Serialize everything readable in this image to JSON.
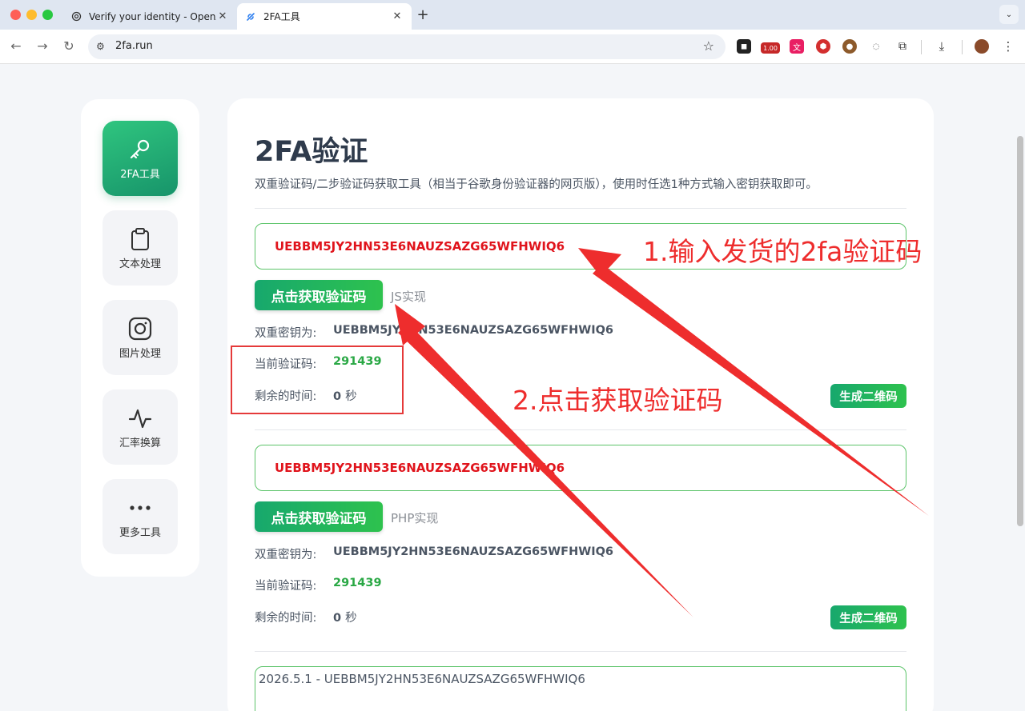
{
  "browser": {
    "tabs": [
      {
        "title": "Verify your identity - OpenAI",
        "icon": "openai-icon",
        "active": false
      },
      {
        "title": "2FA工具",
        "icon": "2fa-site-icon",
        "active": true
      }
    ],
    "url": "2fa.run",
    "extension_badge": "1.00"
  },
  "sidebar": {
    "items": [
      {
        "label": "2FA工具",
        "icon": "key-icon",
        "active": true
      },
      {
        "label": "文本处理",
        "icon": "clipboard-icon",
        "active": false
      },
      {
        "label": "图片处理",
        "icon": "camera-icon",
        "active": false
      },
      {
        "label": "汇率换算",
        "icon": "activity-icon",
        "active": false
      },
      {
        "label": "更多工具",
        "icon": "more-dots-icon",
        "active": false
      }
    ]
  },
  "main": {
    "title": "2FA验证",
    "description": "双重验证码/二步验证码获取工具（相当于谷歌身份验证器的网页版），使用时任选1种方式输入密钥获取即可。",
    "sections": [
      {
        "secret_value": "UEBBM5JY2HN53E6NAUZSAZG65WFHWIQ6",
        "button_label": "点击获取验证码",
        "impl_label": "JS实现",
        "secret_label": "双重密钥为:",
        "secret_display": "UEBBM5JY2HN53E6NAUZSAZG65WFHWIQ6",
        "code_label": "当前验证码:",
        "code_value": "291439",
        "time_label": "剩余的时间:",
        "time_value": "0",
        "time_unit": "秒",
        "qr_button_label": "生成二维码"
      },
      {
        "secret_value": "UEBBM5JY2HN53E6NAUZSAZG65WFHWIQ6",
        "button_label": "点击获取验证码",
        "impl_label": "PHP实现",
        "secret_label": "双重密钥为:",
        "secret_display": "UEBBM5JY2HN53E6NAUZSAZG65WFHWIQ6",
        "code_label": "当前验证码:",
        "code_value": "291439",
        "time_label": "剩余的时间:",
        "time_value": "0",
        "time_unit": "秒",
        "qr_button_label": "生成二维码"
      }
    ],
    "batch_textarea_value": "2026.5.1 - UEBBM5JY2HN53E6NAUZSAZG65WFHWIQ6"
  },
  "annotations": {
    "step1": "1.输入发货的2fa验证码",
    "step2": "2.点击获取验证码",
    "color": "#ee2d2d"
  },
  "colors": {
    "accent_green": "#1fa866",
    "secret_red": "#e0141c",
    "code_green": "#2aa845"
  }
}
